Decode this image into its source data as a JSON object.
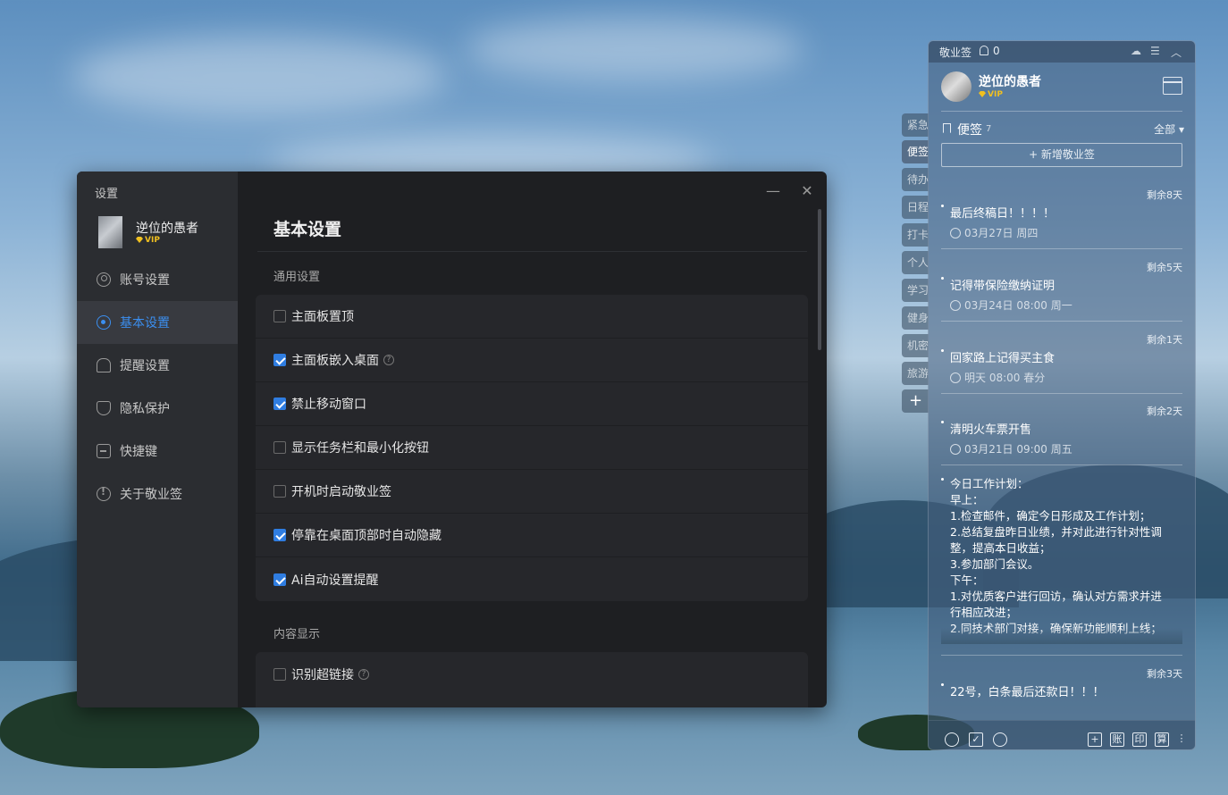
{
  "settings": {
    "window_title": "设置",
    "user": {
      "name": "逆位的愚者",
      "vip": "VIP"
    },
    "nav": [
      {
        "label": "账号设置",
        "icon": "user-circle-icon"
      },
      {
        "label": "基本设置",
        "icon": "target-icon",
        "active": true
      },
      {
        "label": "提醒设置",
        "icon": "bell-icon"
      },
      {
        "label": "隐私保护",
        "icon": "shield-icon"
      },
      {
        "label": "快捷键",
        "icon": "keyboard-icon"
      },
      {
        "label": "关于敬业签",
        "icon": "info-icon"
      }
    ],
    "heading": "基本设置",
    "sections": {
      "general": {
        "title": "通用设置",
        "options": [
          {
            "label": "主面板置顶",
            "checked": false
          },
          {
            "label": "主面板嵌入桌面",
            "checked": true,
            "help": "?"
          },
          {
            "label": "禁止移动窗口",
            "checked": true
          },
          {
            "label": "显示任务栏和最小化按钮",
            "checked": false
          },
          {
            "label": "开机时启动敬业签",
            "checked": false
          },
          {
            "label": "停靠在桌面顶部时自动隐藏",
            "checked": true
          },
          {
            "label": "Ai自动设置提醒",
            "checked": true
          }
        ]
      },
      "display": {
        "title": "内容显示",
        "options": [
          {
            "label": "识别超链接",
            "checked": false,
            "help": "?"
          }
        ]
      }
    },
    "minimize_glyph": "—",
    "close_glyph": "✕"
  },
  "notes_panel": {
    "app_name": "敬业签",
    "notification_count": "0",
    "user": {
      "name": "逆位的愚者",
      "vip": "VIP"
    },
    "category": {
      "name": "便签",
      "count": "7",
      "filter": "全部 ▾"
    },
    "add_button": "+ 新增敬业签",
    "notes": [
      {
        "remain": "剩余8天",
        "title": "最后终稿日！！！！",
        "time": "03月27日 周四"
      },
      {
        "remain": "剩余5天",
        "title": "记得带保险缴纳证明",
        "time": "03月24日 08:00 周一"
      },
      {
        "remain": "剩余1天",
        "title": "回家路上记得买主食",
        "time": "明天 08:00 春分"
      },
      {
        "remain": "剩余2天",
        "title": "清明火车票开售",
        "time": "03月21日 09:00 周五"
      }
    ],
    "plan_lines": [
      "今日工作计划：",
      "早上：",
      "1.检查邮件，确定今日形成及工作计划；",
      "2.总结复盘昨日业绩，并对此进行针对性调",
      "整，提高本日收益；",
      "3.参加部门会议。",
      "下午：",
      "1.对优质客户进行回访，确认对方需求并进",
      "行相应改进；",
      "2.同技术部门对接，确保新功能顺利上线；"
    ],
    "last_note": {
      "remain": "剩余3天",
      "title": "22号，白条最后还款日！！！"
    },
    "bottom_tools": [
      "账",
      "印",
      "算"
    ]
  },
  "side_tabs": [
    "紧急",
    "便签",
    "待办",
    "日程",
    "打卡",
    "个人",
    "学习",
    "健身",
    "机密",
    "旅游",
    "+"
  ]
}
